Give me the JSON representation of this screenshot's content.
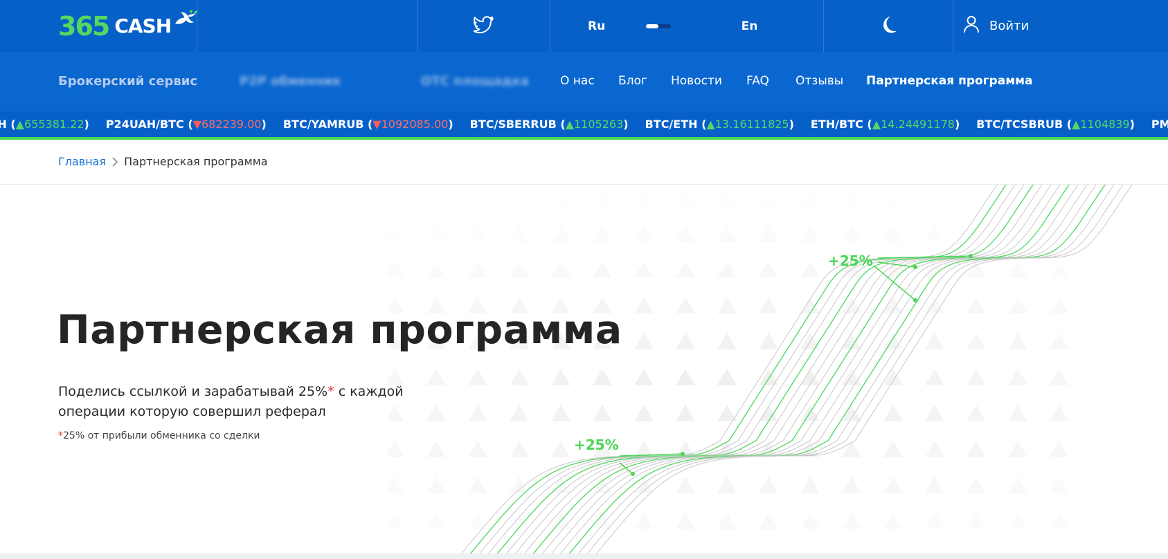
{
  "brand": {
    "logo_number": "365",
    "logo_word": "CASH",
    "accent_green": "#4bd657",
    "primary_blue": "#0660c8"
  },
  "topbar": {
    "twitter_icon": "twitter-icon",
    "lang_ru": "Ru",
    "lang_en": "En",
    "theme_icon": "moon-icon",
    "login_icon": "user-icon",
    "login_label": "Войти"
  },
  "nav": {
    "items": [
      {
        "label": "Брокерский сервис"
      },
      {
        "label": "P2P обменник"
      },
      {
        "label": "OTC площадка"
      },
      {
        "label": "О нас"
      },
      {
        "label": "Блог"
      },
      {
        "label": "Новости"
      },
      {
        "label": "FAQ"
      },
      {
        "label": "Отзывы"
      },
      {
        "label": "Партнерская программа"
      }
    ]
  },
  "ticker": [
    {
      "pair": "AH",
      "dir": "up",
      "arrow": "▲",
      "value": "655381.22"
    },
    {
      "pair": "P24UAH/BTC",
      "dir": "down",
      "arrow": "▼",
      "value": "682239.00"
    },
    {
      "pair": "BTC/YAMRUB",
      "dir": "down",
      "arrow": "▼",
      "value": "1092085.00"
    },
    {
      "pair": "BTC/SBERRUB",
      "dir": "up",
      "arrow": "▲",
      "value": "1105263"
    },
    {
      "pair": "BTC/ETH",
      "dir": "up",
      "arrow": "▲",
      "value": "13.16111825"
    },
    {
      "pair": "ETH/BTC",
      "dir": "up",
      "arrow": "▲",
      "value": "14.24491178"
    },
    {
      "pair": "BTC/TCSBRUB",
      "dir": "up",
      "arrow": "▲",
      "value": "1104839"
    },
    {
      "pair": "PMUSD/BTC",
      "dir": "up",
      "arrow": "",
      "value": ""
    }
  ],
  "breadcrumb": {
    "home": "Главная",
    "current": "Партнерская программа"
  },
  "hero": {
    "title": "Партнерская программа",
    "desc_part1": "Поделись ссылкой и зарабатывай 25%",
    "desc_star": "*",
    "desc_part2": " с каждой операции которую совершил реферал",
    "note_star": "*",
    "note_text": "25% от прибыли обменника со сделки",
    "badge_top": "+25%",
    "badge_bottom": "+25%"
  }
}
